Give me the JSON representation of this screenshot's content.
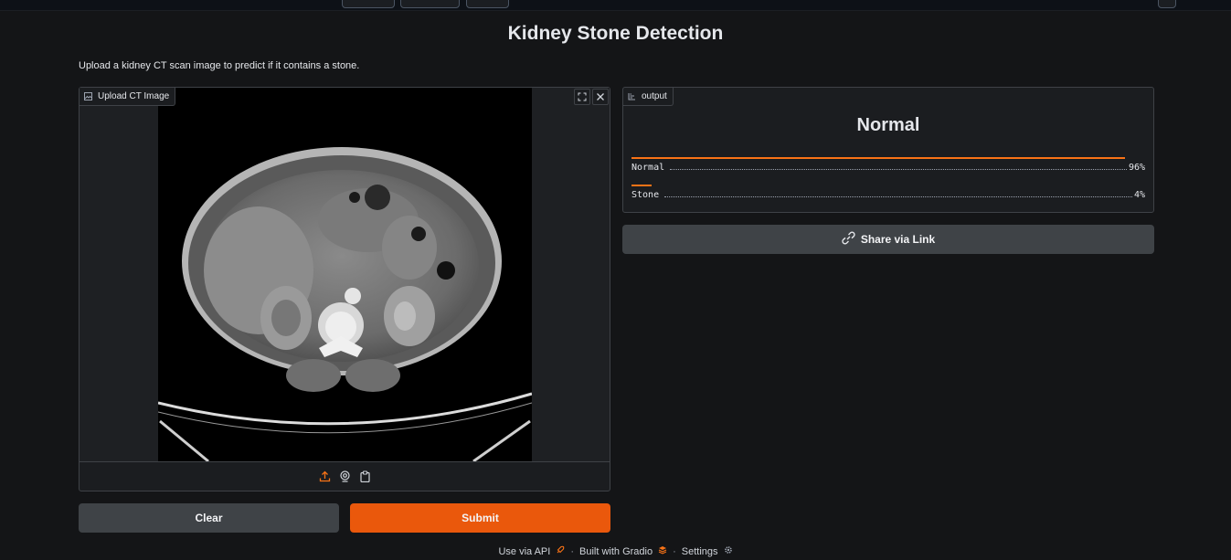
{
  "app": {
    "title": "Kidney Stone Detection",
    "description": "Upload a kidney CT scan image to predict if it contains a stone."
  },
  "input": {
    "label": "Upload CT Image",
    "icon": "image-icon",
    "toolbar_icons": [
      "upload-icon",
      "webcam-icon",
      "clipboard-icon"
    ],
    "corner_icons": [
      "fullscreen-icon",
      "close-icon"
    ]
  },
  "output": {
    "label": "output",
    "icon": "label-icon",
    "prediction": "Normal",
    "confidences": [
      {
        "label": "Normal",
        "value_text": "96%",
        "value": 0.96
      },
      {
        "label": "Stone",
        "value_text": "4%",
        "value": 0.04
      }
    ]
  },
  "buttons": {
    "share": "Share via Link",
    "clear": "Clear",
    "submit": "Submit"
  },
  "footer": {
    "api": "Use via API",
    "built": "Built with Gradio",
    "settings": "Settings"
  },
  "colors": {
    "accent": "#ea580c",
    "background": "#141517",
    "secondary_button": "#3f4347"
  }
}
